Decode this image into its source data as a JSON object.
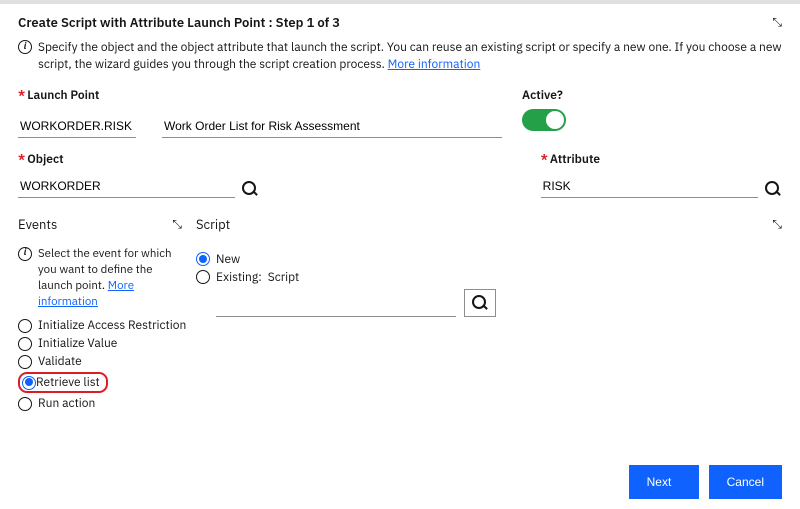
{
  "header": {
    "title": "Create Script with Attribute Launch Point : Step 1 of 3"
  },
  "desc": {
    "text": "Specify the object and the object attribute that launch the script. You can reuse an existing script or specify a new one. If you choose a new script, the wizard guides you through the script creation process. ",
    "more_link": "More information"
  },
  "launch": {
    "label": "Launch Point",
    "value": "WORKORDER.RISK",
    "desc_value": "Work Order List for Risk Assessment"
  },
  "object": {
    "label": "Object",
    "value": "WORKORDER"
  },
  "active": {
    "label": "Active?"
  },
  "attribute": {
    "label": "Attribute",
    "value": "RISK"
  },
  "events": {
    "title": "Events",
    "desc": "Select the event for which you want to define the launch point. ",
    "more_link": "More information",
    "options": [
      "Initialize Access Restriction",
      "Initialize Value",
      "Validate",
      "Retrieve list",
      "Run action"
    ],
    "selected_index": 3
  },
  "script": {
    "title": "Script",
    "options": [
      "New",
      "Existing:"
    ],
    "label_inline": "Script",
    "selected_index": 0
  },
  "footer": {
    "next": "Next",
    "cancel": "Cancel"
  }
}
